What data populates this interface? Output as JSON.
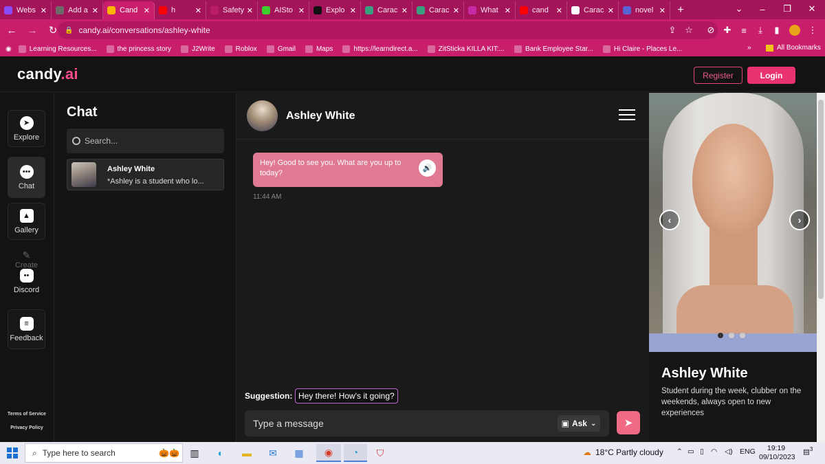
{
  "browser": {
    "tabs": [
      {
        "label": "Webs",
        "color": "#8b4cff"
      },
      {
        "label": "Add a",
        "color": "#6b6b6b"
      },
      {
        "label": "Cand",
        "color": "#ffb400",
        "active": true
      },
      {
        "label": "h",
        "color": "#ff0000"
      },
      {
        "label": "Safety wa",
        "color": "#bb1c66"
      },
      {
        "label": "AISto",
        "color": "#3ccf2e"
      },
      {
        "label": "Explo",
        "color": "#111111"
      },
      {
        "label": "Carac",
        "color": "#3a9f7f"
      },
      {
        "label": "Carac",
        "color": "#3a9f7f"
      },
      {
        "label": "What",
        "color": "#c82aa6"
      },
      {
        "label": "cand",
        "color": "#ff0000"
      },
      {
        "label": "Carac",
        "color": "#ffffff"
      },
      {
        "label": "novel",
        "color": "#5a63d6"
      }
    ],
    "url": "candy.ai/conversations/ashley-white",
    "bookmarks": [
      "Learning Resources...",
      "the princess story",
      "J2Write",
      "Roblox",
      "Gmail",
      "Maps",
      "https://learndirect.a...",
      "ZitSticka KILLA KIT:...",
      "Bank Employee Star...",
      "Hi Claire - Places Le..."
    ],
    "all_bookmarks": "All Bookmarks",
    "more_bookmarks": "»"
  },
  "site": {
    "logo_text": "candy",
    "logo_suffix": ".ai",
    "register_label": "Register",
    "login_label": "Login",
    "nav": [
      {
        "label": "Explore",
        "icon": "compass-icon"
      },
      {
        "label": "Chat",
        "icon": "chat-bubble-icon",
        "active": true
      },
      {
        "label": "Gallery",
        "icon": "image-icon"
      },
      {
        "label": "Create",
        "icon": "pencil-icon"
      },
      {
        "label": "Discord",
        "icon": "discord-icon"
      },
      {
        "label": "Feedback",
        "icon": "feedback-icon"
      }
    ],
    "terms_label": "Terms of Service",
    "privacy_label": "Privacy Policy"
  },
  "chat_list": {
    "title": "Chat",
    "search_placeholder": "Search...",
    "conversations": [
      {
        "name": "Ashley White",
        "preview": "*Ashley is a student who lo..."
      }
    ]
  },
  "conversation": {
    "name": "Ashley White",
    "messages": [
      {
        "text": "Hey! Good to see you. What are you up to today?",
        "time": "11:44 AM"
      }
    ],
    "suggestion_label": "Suggestion:",
    "suggestion_text": "Hey there! How's it going?",
    "input_placeholder": "Type a message",
    "ask_label": "Ask"
  },
  "profile": {
    "name": "Ashley White",
    "description": "Student during the week, clubber on the weekends, always open to new experiences",
    "carousel_index": 1,
    "carousel_count": 3
  },
  "taskbar": {
    "search_placeholder": "Type here to search",
    "weather": "18°C  Partly cloudy",
    "language": "ENG",
    "time": "19:19",
    "date": "09/10/2023",
    "notification_count": "3"
  }
}
